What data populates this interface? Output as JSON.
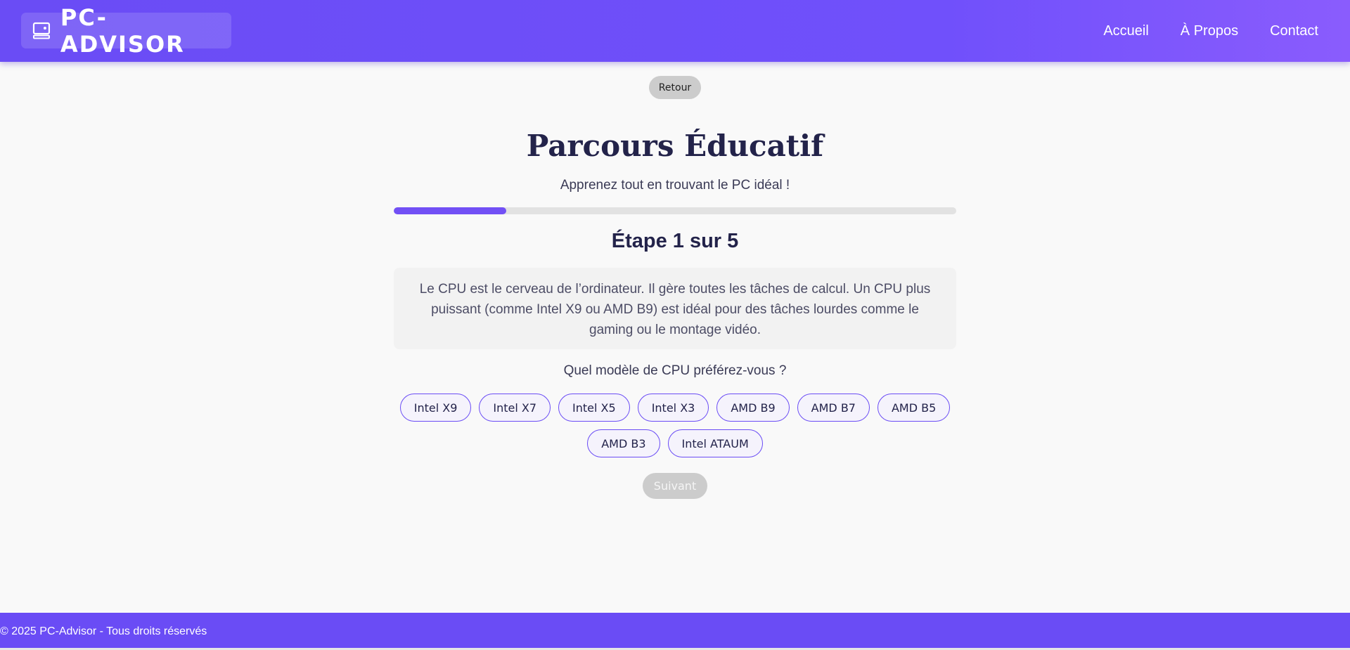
{
  "header": {
    "logo_text": "PC-ADVISOR",
    "nav": [
      "Accueil",
      "À Propos",
      "Contact"
    ]
  },
  "back_label": "Retour",
  "title": "Parcours Éducatif",
  "subtitle": "Apprenez tout en trouvant le PC idéal !",
  "progress": {
    "current_step": 1,
    "total_steps": 5,
    "fraction": 0.2
  },
  "step_label": "Étape 1 sur 5",
  "info_text": "Le CPU est le cerveau de l’ordinateur. Il gère toutes les tâches de calcul. Un CPU plus puissant (comme Intel X9 ou AMD B9) est idéal pour des tâches lourdes comme le gaming ou le montage vidéo.",
  "question": "Quel modèle de CPU préférez-vous ?",
  "options": [
    "Intel X9",
    "Intel X7",
    "Intel X5",
    "Intel X3",
    "AMD B9",
    "AMD B7",
    "AMD B5",
    "AMD B3",
    "Intel ATAUM"
  ],
  "next_label": "Suivant",
  "footer_text": "© 2025 PC-Advisor - Tous droits réservés",
  "colors": {
    "accent": "#6a4cf5",
    "disabled": "#cccccc"
  },
  "icons": {
    "logo": "computer-icon"
  }
}
